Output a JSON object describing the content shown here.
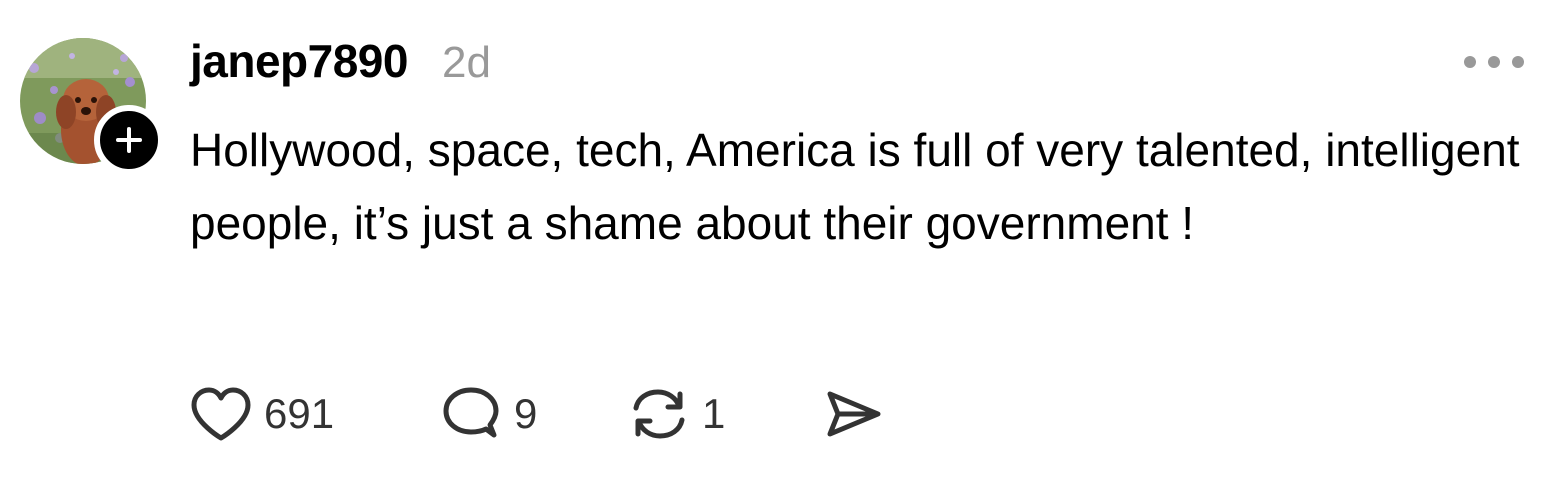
{
  "post": {
    "avatar": {
      "icon": "dog-avatar-photo",
      "follow_icon": "plus-icon"
    },
    "username": "janep7890",
    "timestamp": "2d",
    "more_icon": "more-dots-icon",
    "text": "Hollywood, space, tech, America is full of very talented, intelligent people, it’s just a shame about their government !",
    "actions": {
      "like": {
        "icon": "heart-icon",
        "count": "691"
      },
      "reply": {
        "icon": "comment-bubble-icon",
        "count": "9"
      },
      "repost": {
        "icon": "repost-icon",
        "count": "1"
      },
      "share": {
        "icon": "send-icon"
      }
    }
  },
  "colors": {
    "text": "#000000",
    "muted": "#999999",
    "count": "#333333",
    "badge": "#000000",
    "background": "#ffffff"
  }
}
